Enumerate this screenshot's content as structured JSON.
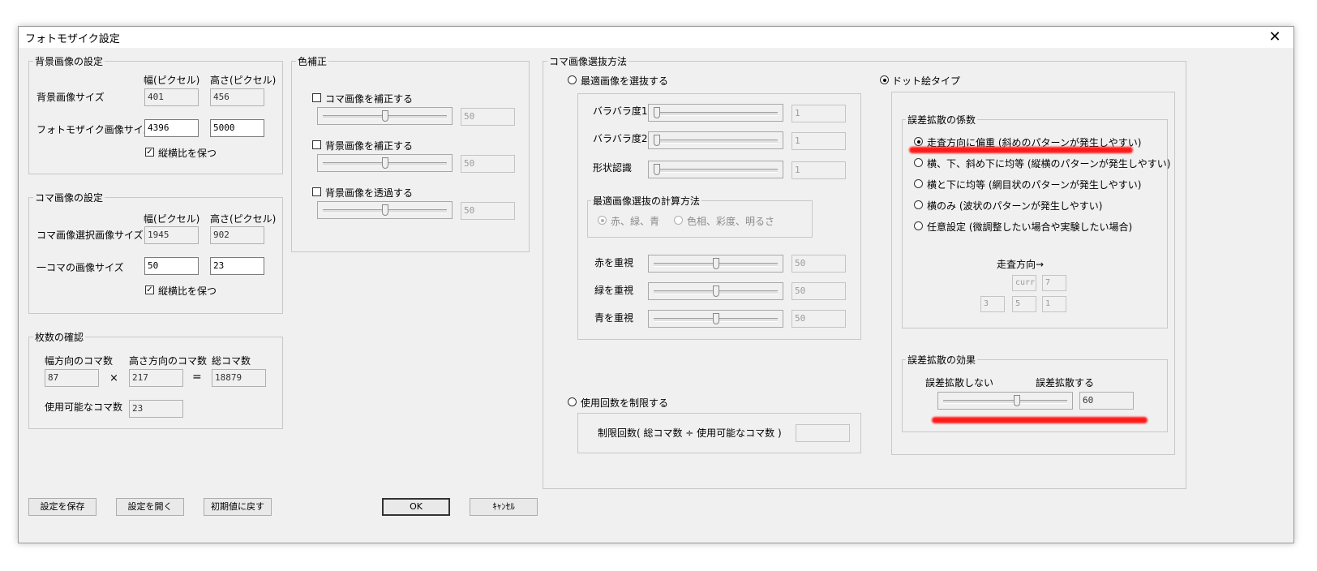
{
  "window": {
    "title": "フォトモザイク設定",
    "close_glyph": "✕"
  },
  "bg_group": {
    "legend": "背景画像の設定",
    "col_width": "幅(ピクセル)",
    "col_height": "高さ(ピクセル)",
    "bg_size_label": "背景画像サイズ",
    "bg_w": "401",
    "bg_h": "456",
    "mosaic_size_label": "フォトモザイク画像サイズ",
    "mosaic_w": "4396",
    "mosaic_h": "5000",
    "keep_aspect": "縦横比を保つ",
    "keep_aspect_checked": true
  },
  "tile_group": {
    "legend": "コマ画像の設定",
    "col_width": "幅(ピクセル)",
    "col_height": "高さ(ピクセル)",
    "select_size_label": "コマ画像選択画像サイズ",
    "select_w": "1945",
    "select_h": "902",
    "tile_size_label": "一コマの画像サイズ",
    "tile_w": "50",
    "tile_h": "23",
    "keep_aspect": "縦横比を保つ",
    "keep_aspect_checked": true
  },
  "count_group": {
    "legend": "枚数の確認",
    "w_count_label": "幅方向のコマ数",
    "h_count_label": "高さ方向のコマ数",
    "total_label": "総コマ数",
    "w_count": "87",
    "times": "×",
    "h_count": "217",
    "equals": "=",
    "total": "18879",
    "usable_label": "使用可能なコマ数",
    "usable": "23"
  },
  "color_group": {
    "legend": "色補正",
    "items": [
      {
        "label": "コマ画像を補正する",
        "value": "50",
        "level": 0.5
      },
      {
        "label": "背景画像を補正する",
        "value": "50",
        "level": 0.5
      },
      {
        "label": "背景画像を透過する",
        "value": "50",
        "level": 0.5
      }
    ]
  },
  "select_group": {
    "legend": "コマ画像選抜方法",
    "optimal_radio": "最適画像を選抜する",
    "scatter1_label": "バラバラ度1",
    "scatter1_value": "1",
    "scatter1_level": 0.0,
    "scatter2_label": "バラバラ度2",
    "scatter2_value": "1",
    "scatter2_level": 0.0,
    "shape_label": "形状認識",
    "shape_value": "1",
    "shape_level": 0.0,
    "calc_legend": "最適画像選抜の計算方法",
    "calc_rgb": "赤、緑、青",
    "calc_hsv": "色相、彩度、明るさ",
    "red_label": "赤を重視",
    "red_value": "50",
    "red_level": 0.5,
    "green_label": "緑を重視",
    "green_value": "50",
    "green_level": 0.5,
    "blue_label": "青を重視",
    "blue_value": "50",
    "blue_level": 0.5,
    "limit_radio": "使用回数を制限する",
    "limit_text": "制限回数( 総コマ数 ÷ 使用可能なコマ数 )",
    "limit_value": "",
    "dot_radio": "ドット絵タイプ"
  },
  "coef_group": {
    "legend": "誤差拡散の係数",
    "options": [
      "走査方向に偏重 (斜めのパターンが発生しやすい)",
      "横、下、斜め下に均等 (縦横のパターンが発生しやすい)",
      "横と下に均等 (網目状のパターンが発生しやすい)",
      "横のみ (波状のパターンが発生しやすい)",
      "任意設定 (微調整したい場合や実験したい場合)"
    ],
    "selected_index": 0,
    "scan_dir": "走査方向→",
    "curr": "curr",
    "c_right": "7",
    "c_bl": "3",
    "c_b": "5",
    "c_br": "1"
  },
  "effect_group": {
    "legend": "誤差拡散の効果",
    "none_label": "誤差拡散しない",
    "do_label": "誤差拡散する",
    "value": "60",
    "level": 0.6
  },
  "buttons": {
    "save": "設定を保存",
    "open": "設定を開く",
    "reset": "初期値に戻す",
    "ok": "OK",
    "cancel": "ｷｬﾝｾﾙ"
  },
  "annotation_color": "#ff1a1a"
}
